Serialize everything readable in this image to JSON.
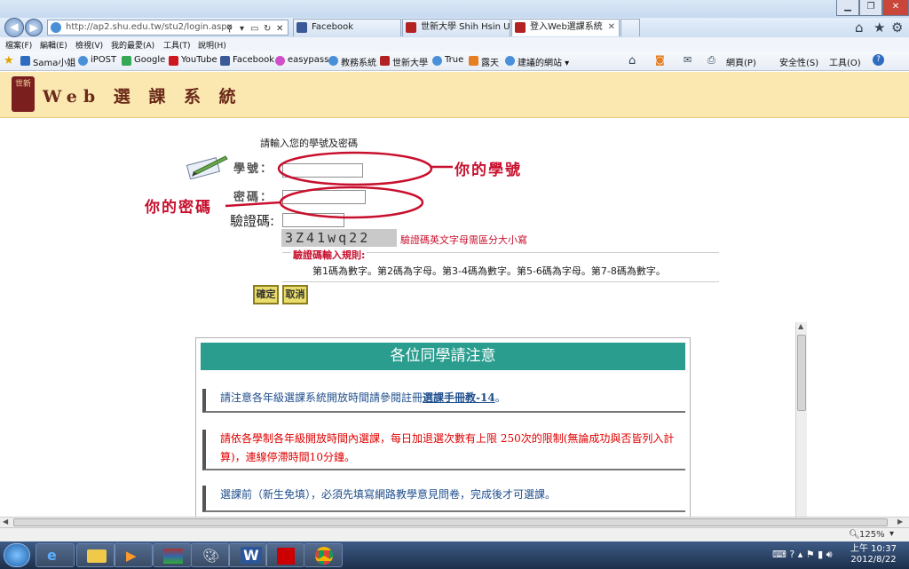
{
  "browser": {
    "url": "http://ap2.shu.edu.tw/stu2/login.aspx",
    "tabs": [
      {
        "label": "Facebook",
        "color": "#3b5998"
      },
      {
        "label": "世新大學 Shih Hsin Un...",
        "color": "#b22222"
      },
      {
        "label": "登入Web選課系統",
        "color": "#b22222"
      }
    ],
    "menus": [
      "檔案(F)",
      "編輯(E)",
      "檢視(V)",
      "我的最愛(A)",
      "工具(T)",
      "說明(H)"
    ],
    "favorites": [
      "Sama小姐",
      "iPOST",
      "Google",
      "YouTube",
      "Facebook",
      "easypass",
      "教務系統",
      "世新大學",
      "True",
      "露天",
      "建議的網站"
    ],
    "commandbar": [
      "網頁(P)",
      "安全性(S)",
      "工具(O)"
    ]
  },
  "page": {
    "system_title": "Web 選 課 系 統",
    "logo_text": "世新",
    "prompt": "請輸入您的學號及密碼",
    "student_id_label": "學號：",
    "password_label": "密碼：",
    "captcha_label": "驗證碼:",
    "captcha_code": "3Z41wq22",
    "case_note": "驗證碼英文字母需區分大小寫",
    "rule_title": "驗證碼輸入規則:",
    "rule_text": "第1碼為數字。第2碼為字母。第3-4碼為數字。第5-6碼為字母。第7-8碼為數字。",
    "ok_button": "確定",
    "cancel_button": "取消",
    "notice_title": "各位同學請注意",
    "notice1_prefix": "請注意各年級選課系統開放時間請參閱註冊",
    "notice1_link": "選課手冊教-14",
    "notice1_suffix": "。",
    "notice2": "請依各學制各年級開放時間內選課，每日加退選次數有上限 250次的限制(無論成功與否皆列入計算)，連線停滯時間10分鐘。",
    "notice3": "選課前（新生免填），必須先填寫網路教學意見問卷，完成後才可選課。"
  },
  "annotations": {
    "student_id": "你的學號",
    "password": "你的密碼",
    "color": "#c8102e"
  },
  "status": {
    "zoom": "125%"
  },
  "clock": {
    "time": "上午 10:37",
    "date": "2012/8/22"
  }
}
